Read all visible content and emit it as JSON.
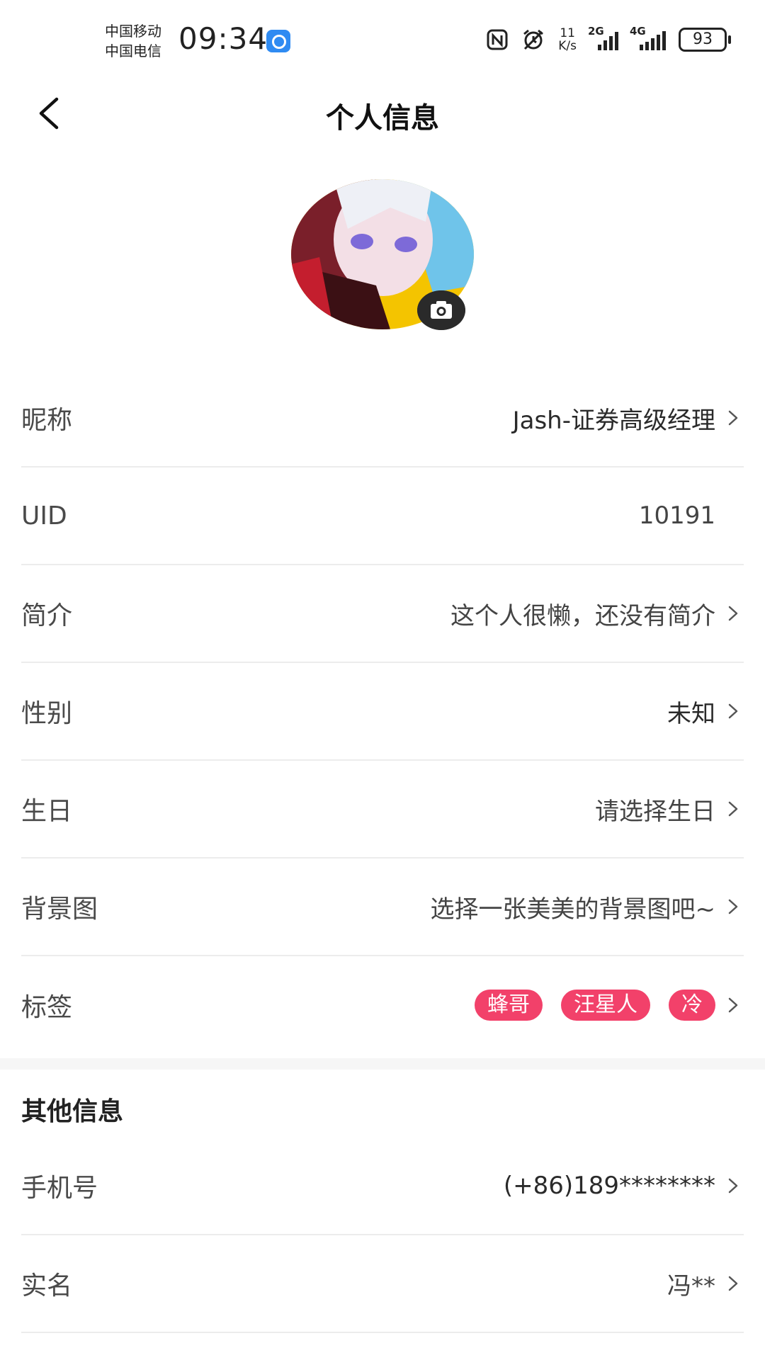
{
  "status_bar": {
    "carrier_1": "中国移动",
    "carrier_2": "中国电信",
    "time": "09:34",
    "net_speed_value": "11",
    "net_speed_unit": "K/s",
    "signal_1_gen": "2G",
    "signal_2_gen": "4G",
    "battery": "93"
  },
  "header": {
    "title": "个人信息"
  },
  "profile": {
    "rows": [
      {
        "label": "昵称",
        "value": "Jash-证券高级经理"
      },
      {
        "label": "UID",
        "value": "10191"
      },
      {
        "label": "简介",
        "value": "这个人很懒，还没有简介"
      },
      {
        "label": "性别",
        "value": "未知"
      },
      {
        "label": "生日",
        "value": "请选择生日"
      },
      {
        "label": "背景图",
        "value": "选择一张美美的背景图吧~"
      },
      {
        "label": "标签",
        "tags": [
          "蜂哥",
          "汪星人",
          "冷"
        ]
      }
    ]
  },
  "other": {
    "section_title": "其他信息",
    "rows": [
      {
        "label": "手机号",
        "value": "(+86)189********"
      },
      {
        "label": "实名",
        "value": "冯**"
      }
    ]
  },
  "colors": {
    "tag_bg": "#f2416a",
    "divider": "#ececec",
    "text": "#444444"
  },
  "icons": [
    "back-arrow-icon",
    "camera-icon",
    "chevron-right-icon",
    "nfc-icon",
    "alarm-icon",
    "signal-icon",
    "battery-icon"
  ]
}
